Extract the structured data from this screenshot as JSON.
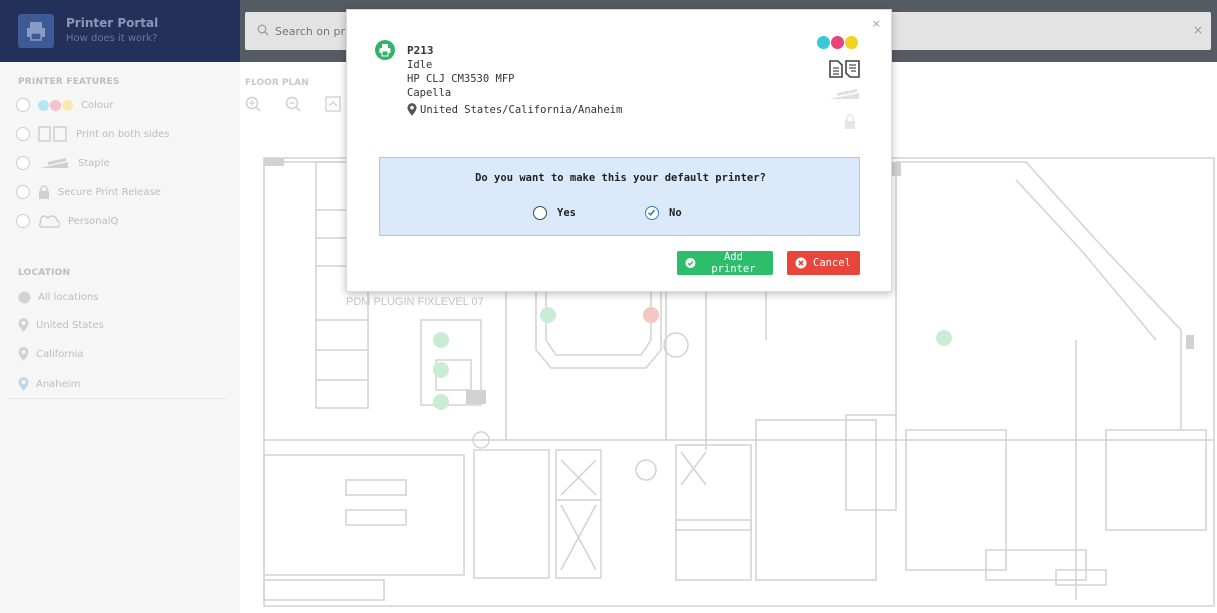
{
  "app": {
    "title": "Printer Portal",
    "subtitle": "How does it work?"
  },
  "search": {
    "placeholder": "Search on printer name..."
  },
  "sidebar": {
    "features_title": "PRINTER FEATURES",
    "features": [
      {
        "label": "Colour",
        "icon": "colour-dots-icon"
      },
      {
        "label": "Print on both sides",
        "icon": "duplex-icon"
      },
      {
        "label": "Staple",
        "icon": "staple-icon"
      },
      {
        "label": "Secure Print Release",
        "icon": "lock-icon"
      },
      {
        "label": "PersonalQ",
        "icon": "cloud-icon"
      }
    ],
    "location_title": "LOCATION",
    "locations": [
      "All locations",
      "United States",
      "California",
      "Anaheim"
    ]
  },
  "floorplan": {
    "title": "FLOOR PLAN",
    "plan_label": "PDM PLUGIN FIXLEVEL 07"
  },
  "modal": {
    "printer": {
      "name": "P213",
      "status": "Idle",
      "model": "HP CLJ CM3530 MFP",
      "location": "Capella",
      "path": "United States/California/Anaheim"
    },
    "question": "Do you want to make this your default printer?",
    "options": {
      "yes": "Yes",
      "no": "No",
      "selected": "No"
    },
    "buttons": {
      "add": "Add printer",
      "cancel": "Cancel"
    },
    "close": "×"
  },
  "colors": {
    "cyan": "#38c8d8",
    "magenta": "#e8437a",
    "yellow": "#f2d21c",
    "add": "#2ebd6b",
    "cancel": "#e9453a",
    "question_bg": "#dbeafb"
  }
}
